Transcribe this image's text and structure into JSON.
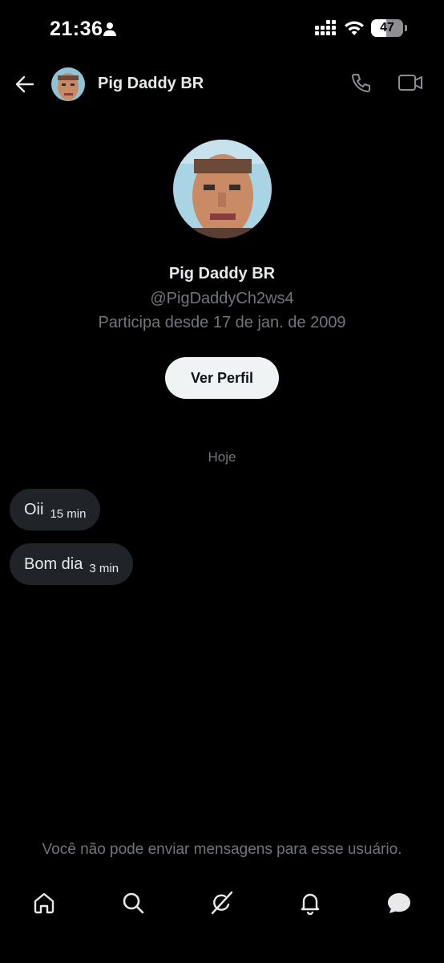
{
  "status_bar": {
    "time": "21:36",
    "battery_level": "47",
    "battery_fraction": 0.47
  },
  "header": {
    "contact_name": "Pig Daddy BR"
  },
  "profile": {
    "name": "Pig Daddy BR",
    "handle": "@PigDaddyCh2ws4",
    "joined": "Participa desde 17 de jan. de 2009",
    "view_profile_label": "Ver Perfil"
  },
  "conversation": {
    "date_separator": "Hoje",
    "messages": [
      {
        "text": "Oii",
        "time": "15 min"
      },
      {
        "text": "Bom dia",
        "time": "3 min"
      }
    ]
  },
  "notice": "Você não pode enviar mensagens para esse usuário.",
  "icons": {
    "back": "arrow-left-icon",
    "call": "phone-icon",
    "video": "video-camera-icon",
    "tabs": [
      "home-icon",
      "search-icon",
      "grok-icon",
      "bell-icon",
      "messages-icon"
    ]
  },
  "colors": {
    "background": "#000000",
    "primary_text": "#e7e9ea",
    "secondary_text": "#71767b",
    "bubble": "#202327",
    "button_bg": "#eff3f4"
  }
}
